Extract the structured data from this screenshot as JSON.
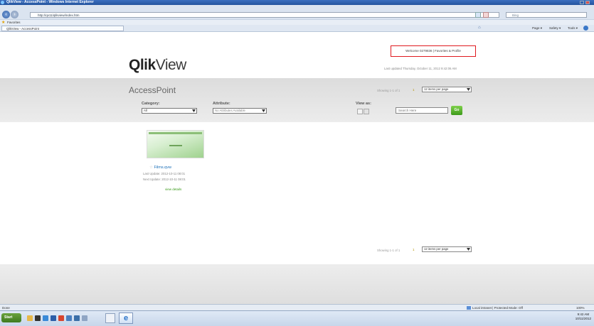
{
  "window": {
    "title": "QlikView - AccessPoint - Windows Internet Explorer"
  },
  "browser": {
    "address": "http://qv11/qlikview/index.htm",
    "search_placeholder": "Bing",
    "favorites_label": "Favorites",
    "tab_label": "QlikView - AccessPoint",
    "toolbar_items": [
      "Page ▾",
      "Safety ▾",
      "Tools ▾"
    ]
  },
  "header": {
    "logo_qlik": "Qlik",
    "logo_view": "View",
    "welcome": "Welcome 0279836 | Favorites & Profile",
    "last_updated": "Last updated Thursday, October 11, 2012 9:42:06 AM"
  },
  "accesspoint": {
    "title": "AccessPoint",
    "showing_top": "Showing 1-1 of 1",
    "page_num": "1",
    "per_page": "12 items per page",
    "category_label": "Category:",
    "category_value": "All",
    "attribute_label": "Attribute:",
    "attribute_value": "No Attributes Available",
    "view_as_label": "View as:",
    "search_placeholder": "Search Here",
    "go_label": "Go",
    "showing_bottom": "Showing 1-1 of 1"
  },
  "document": {
    "name": "Films.qvw",
    "last_update": "Last Update: 2012-10-11 08:01",
    "next_update": "Next Update: 2012-10-11 08:01",
    "view_details": "view details"
  },
  "status": {
    "left": "Done",
    "zone": "Local intranet | Protected Mode: Off",
    "zoom": "100%"
  },
  "taskbar": {
    "start_label": "Start",
    "time": "9:42 AM",
    "date": "10/11/2012"
  },
  "colors": {
    "accent_green": "#3d9a1a",
    "link_blue": "#1b6fb8",
    "highlight_red": "#e0191f"
  }
}
